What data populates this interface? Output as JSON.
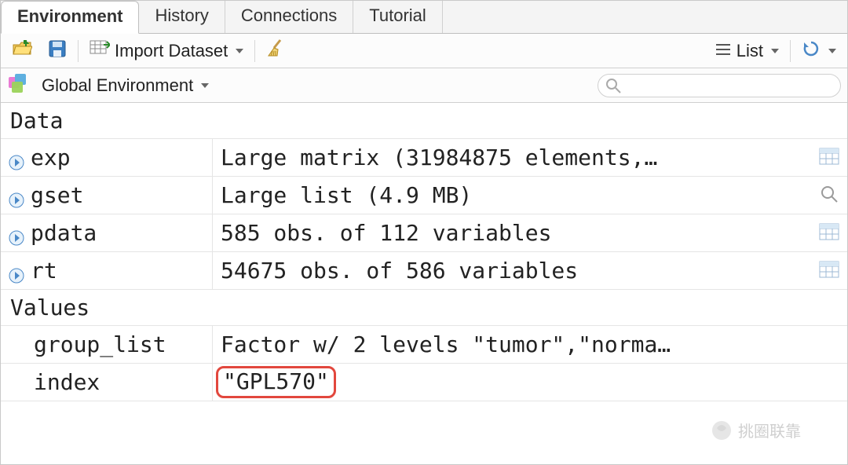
{
  "tabs": [
    "Environment",
    "History",
    "Connections",
    "Tutorial"
  ],
  "active_tab": 0,
  "toolbar": {
    "import_label": "Import Dataset",
    "list_view_label": "List"
  },
  "scope": {
    "label": "Global Environment",
    "search_placeholder": ""
  },
  "env": {
    "sections": [
      {
        "title": "Data",
        "rows": [
          {
            "name": "exp",
            "value": "Large matrix (31984875 elements,…",
            "expandable": true,
            "action": "grid"
          },
          {
            "name": "gset",
            "value": "Large list (4.9 MB)",
            "expandable": true,
            "action": "search"
          },
          {
            "name": "pdata",
            "value": "585 obs. of 112 variables",
            "expandable": true,
            "action": "grid"
          },
          {
            "name": "rt",
            "value": "54675 obs. of 586 variables",
            "expandable": true,
            "action": "grid"
          }
        ]
      },
      {
        "title": "Values",
        "rows": [
          {
            "name": "group_list",
            "value": "Factor w/ 2 levels \"tumor\",\"norma…",
            "expandable": false,
            "action": ""
          },
          {
            "name": "index",
            "value": "\"GPL570\"",
            "expandable": false,
            "action": "",
            "highlight": true
          }
        ]
      }
    ]
  },
  "watermark": "挑圈联靠"
}
